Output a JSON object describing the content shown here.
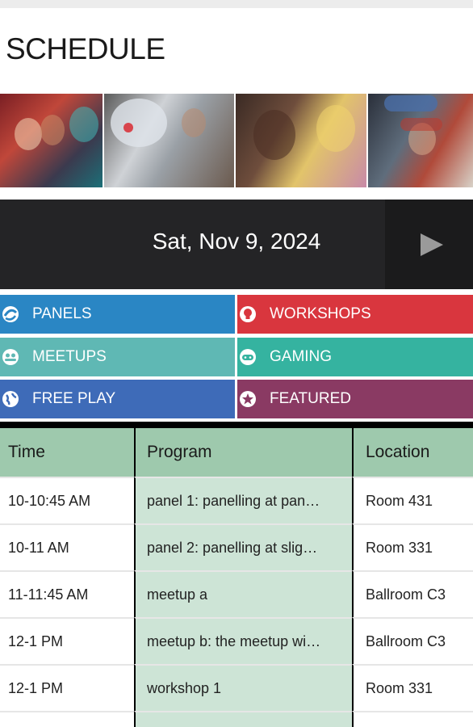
{
  "page": {
    "title": "SCHEDULE"
  },
  "banner": {
    "photos": [
      "cosplay-group-photo",
      "r2d2-photo",
      "cosplay-duo-photo",
      "we-can-do-it-cosplay-photo"
    ]
  },
  "date_nav": {
    "date": "Sat, Nov 9, 2024",
    "next_icon": "play-right-icon"
  },
  "categories": [
    {
      "label": "PANELS",
      "icon": "swirl-icon",
      "color": "#2a86c4"
    },
    {
      "label": "WORKSHOPS",
      "icon": "lightbulb-icon",
      "color": "#d9363e"
    },
    {
      "label": "MEETUPS",
      "icon": "people-icon",
      "color": "#5fb8b4"
    },
    {
      "label": "GAMING",
      "icon": "gamepad-icon",
      "color": "#35b3a0"
    },
    {
      "label": "FREE PLAY",
      "icon": "globe-icon",
      "color": "#3e6bb8"
    },
    {
      "label": "FEATURED",
      "icon": "star-icon",
      "color": "#8a3a63"
    }
  ],
  "table": {
    "headers": [
      "Time",
      "Program",
      "Location"
    ],
    "rows": [
      {
        "time": "10-10:45 AM",
        "program": "panel 1: panelling at pan…",
        "location": "Room 431"
      },
      {
        "time": "10-11 AM",
        "program": "panel 2: panelling at slig…",
        "location": "Room 331"
      },
      {
        "time": "11-11:45 AM",
        "program": "meetup a",
        "location": "Ballroom C3"
      },
      {
        "time": "12-1 PM",
        "program": "meetup b: the meetup wi…",
        "location": "Ballroom C3"
      },
      {
        "time": "12-1 PM",
        "program": "workshop 1",
        "location": "Room 331"
      }
    ]
  }
}
